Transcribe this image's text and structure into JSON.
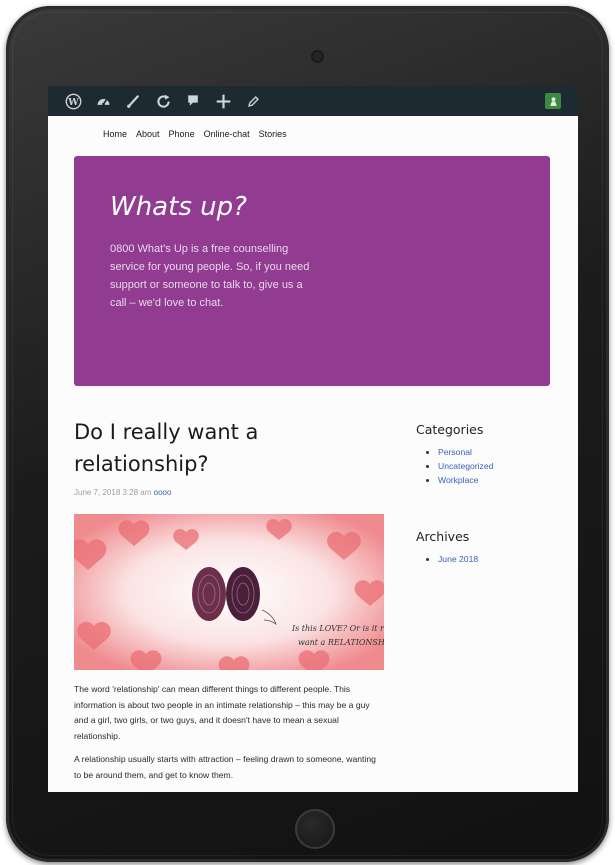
{
  "nav": {
    "items": [
      "Home",
      "About",
      "Phone",
      "Online-chat",
      "Stories"
    ]
  },
  "hero": {
    "title": "Whats up?",
    "text": "0800 What's Up is a free counselling service for young people. So, if you need support or someone to talk to, give us a call – we'd love to chat."
  },
  "post": {
    "title": "Do I really want a relationship?",
    "date": "June 7, 2018 3:28 am",
    "author": "oooo",
    "image_caption": "Is this LOVE? Or is it really want a RELATIONSHIP?",
    "paragraphs": [
      "The word 'relationship' can mean different things to different people. This information is about two people in an intimate relationship – this may be a guy and a girl, two girls, or two guys, and it doesn't have to mean a sexual relationship.",
      "A relationship usually starts with attraction – feeling drawn to someone, wanting to be around them, and get to know them."
    ]
  },
  "sidebar": {
    "categories": {
      "title": "Categories",
      "items": [
        "Personal",
        "Uncategorized",
        "Workplace"
      ]
    },
    "archives": {
      "title": "Archives",
      "items": [
        "June 2018"
      ]
    }
  },
  "colors": {
    "hero_bg": "#913b91",
    "admin_bar_bg": "#1d2a31",
    "link": "#3a62b8"
  },
  "icons": [
    "wordpress-icon",
    "dashboard-icon",
    "customize-brush-icon",
    "updates-icon",
    "comments-icon",
    "new-content-icon",
    "edit-icon",
    "user-avatar-icon"
  ]
}
